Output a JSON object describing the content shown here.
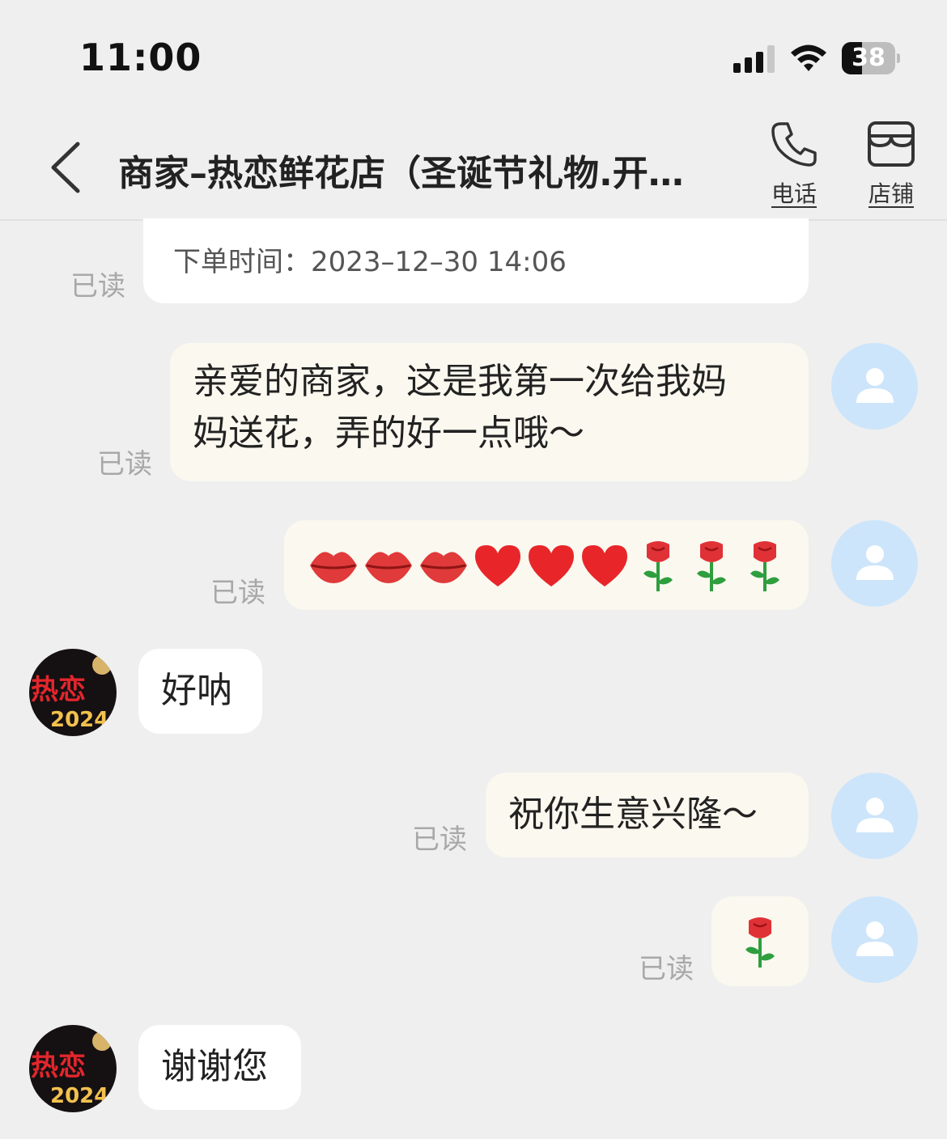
{
  "status_bar": {
    "time": "11:00",
    "battery_level": "38",
    "icons": [
      "cellular-signal-icon",
      "wifi-icon",
      "battery-icon"
    ]
  },
  "header": {
    "back_icon": "chevron-left-icon",
    "title": "商家–热恋鲜花店（圣诞节礼物.开…",
    "actions": [
      {
        "icon": "phone-icon",
        "label": "电话"
      },
      {
        "icon": "store-icon",
        "label": "店铺"
      }
    ]
  },
  "order_card": {
    "text": "下单时间：2023–12–30 14:06",
    "read_status": "已读"
  },
  "shop_avatar": {
    "logo_text": "热恋",
    "year_text": "2024"
  },
  "messages": [
    {
      "side": "out",
      "text": "亲爱的商家，这是我第一次给我妈妈送花，弄的好一点哦～",
      "lines": [
        "亲爱的商家，这是我第一次给我妈",
        "妈送花，弄的好一点哦～"
      ],
      "read_status": "已读"
    },
    {
      "side": "out",
      "type": "emoji",
      "emojis": [
        "lips-icon",
        "lips-icon",
        "lips-icon",
        "red-heart-icon",
        "red-heart-icon",
        "red-heart-icon",
        "rose-icon",
        "rose-icon",
        "rose-icon"
      ],
      "read_status": "已读"
    },
    {
      "side": "in",
      "text": "好呐"
    },
    {
      "side": "out",
      "text": "祝你生意兴隆～",
      "read_status": "已读"
    },
    {
      "side": "out",
      "type": "emoji",
      "emojis": [
        "rose-icon"
      ],
      "read_status": "已读"
    },
    {
      "side": "in",
      "text": "谢谢您"
    }
  ],
  "colors": {
    "background": "#efefef",
    "outgoing_bubble": "#faf8ef",
    "incoming_bubble": "#ffffff",
    "user_avatar": "#cce5fb",
    "read_text": "#a8a8a8"
  }
}
